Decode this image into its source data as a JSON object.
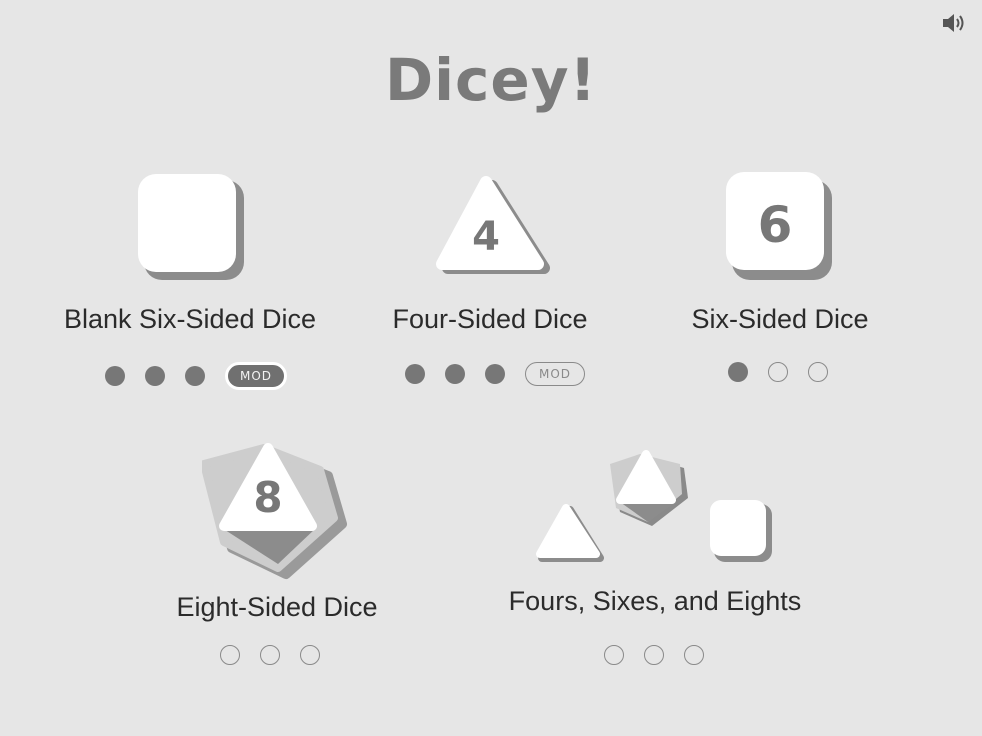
{
  "title": "Dicey!",
  "sound_icon": "speaker-volume-icon",
  "games": [
    {
      "label": "Blank Six-Sided Dice",
      "die_type": "blank-square",
      "progress": [
        "filled",
        "filled",
        "filled"
      ],
      "mod": {
        "label": "MOD",
        "state": "active"
      }
    },
    {
      "label": "Four-Sided Dice",
      "die_type": "triangle",
      "die_number": "4",
      "progress": [
        "filled",
        "filled",
        "filled"
      ],
      "mod": {
        "label": "MOD",
        "state": "inactive"
      }
    },
    {
      "label": "Six-Sided Dice",
      "die_type": "square",
      "die_number": "6",
      "progress": [
        "filled",
        "empty",
        "empty"
      ]
    },
    {
      "label": "Eight-Sided Dice",
      "die_type": "octahedron",
      "die_number": "8",
      "progress": [
        "empty",
        "empty",
        "empty"
      ]
    },
    {
      "label": "Fours, Sixes, and Eights",
      "die_type": "mixed",
      "progress": [
        "empty",
        "empty",
        "empty"
      ]
    }
  ],
  "colors": {
    "background": "#e6e6e6",
    "die_face": "#ffffff",
    "die_shadow": "#8c8c8c",
    "number": "#777777",
    "progress_filled": "#777777"
  }
}
